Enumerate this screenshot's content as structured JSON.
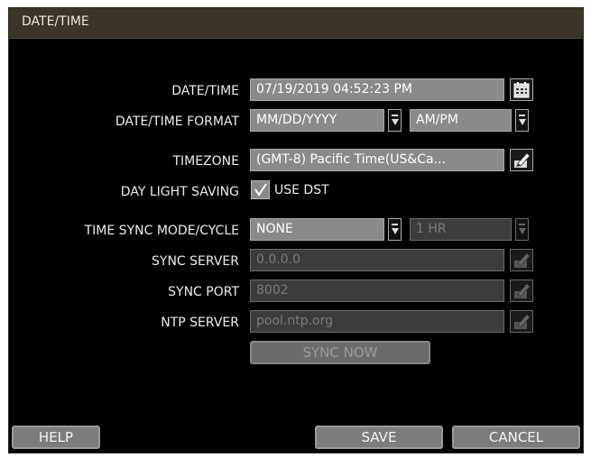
{
  "window": {
    "title": "DATE/TIME"
  },
  "form": {
    "datetime": {
      "label": "DATE/TIME",
      "value": "07/19/2019 04:52:23 PM",
      "icon": "calendar-icon"
    },
    "format": {
      "label": "DATE/TIME FORMAT",
      "date_format": "MM/DD/YYYY",
      "time_format": "AM/PM"
    },
    "timezone": {
      "label": "TIMEZONE",
      "value": "(GMT-8) Pacific Time(US&Ca...",
      "icon": "edit-icon"
    },
    "dst": {
      "label": "DAY LIGHT SAVING",
      "checked": true,
      "option_label": "USE DST"
    },
    "sync_mode": {
      "label": "TIME SYNC MODE/CYCLE",
      "mode": "NONE",
      "cycle": "1 HR"
    },
    "sync_server": {
      "label": "SYNC SERVER",
      "value": "0.0.0.0"
    },
    "sync_port": {
      "label": "SYNC PORT",
      "value": "8002"
    },
    "ntp_server": {
      "label": "NTP SERVER",
      "value": "pool.ntp.org"
    },
    "sync_now_label": "SYNC NOW"
  },
  "footer": {
    "help_label": "HELP",
    "save_label": "SAVE",
    "cancel_label": "CANCEL"
  },
  "colors": {
    "background": "#000000",
    "titlebar": "#3d3429",
    "field": "#8a8a8a",
    "field_disabled": "#3c3c3c"
  }
}
